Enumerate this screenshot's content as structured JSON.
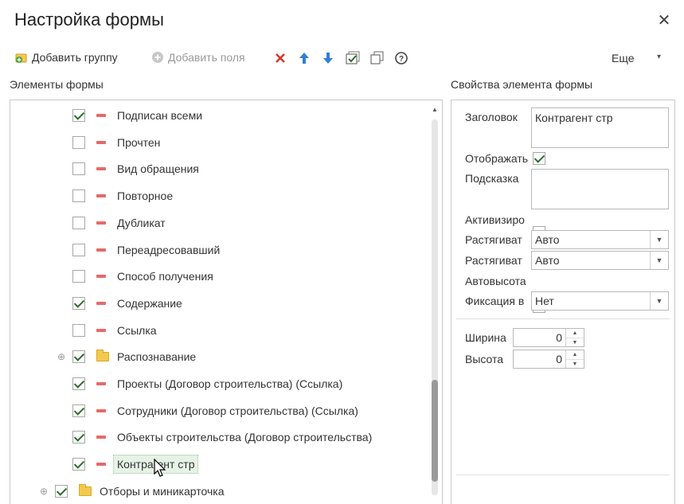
{
  "window": {
    "title": "Настройка формы",
    "close_glyph": "✕"
  },
  "toolbar": {
    "add_group": "Добавить группу",
    "add_field": "Добавить поля",
    "more": "Еще",
    "more_arrow": "▾"
  },
  "left_panel": {
    "heading": "Элементы формы",
    "rows": [
      {
        "label": "Подписан всеми",
        "checked": true,
        "icon": "minus-icon"
      },
      {
        "label": "Прочтен",
        "checked": false,
        "icon": "minus-icon"
      },
      {
        "label": "Вид обращения",
        "checked": false,
        "icon": "minus-icon"
      },
      {
        "label": "Повторное",
        "checked": false,
        "icon": "minus-icon"
      },
      {
        "label": "Дубликат",
        "checked": false,
        "icon": "minus-icon"
      },
      {
        "label": "Переадресовавший",
        "checked": false,
        "icon": "minus-icon"
      },
      {
        "label": "Способ получения",
        "checked": false,
        "icon": "minus-icon"
      },
      {
        "label": "Содержание",
        "checked": true,
        "icon": "minus-icon"
      },
      {
        "label": "Ссылка",
        "checked": false,
        "icon": "minus-icon"
      },
      {
        "label": "Распознавание",
        "checked": true,
        "icon": "folder-icon",
        "expander": "⊕"
      },
      {
        "label": "Проекты (Договор строительства) (Ссылка)",
        "checked": true,
        "icon": "minus-icon"
      },
      {
        "label": "Сотрудники (Договор строительства) (Ссылка)",
        "checked": true,
        "icon": "minus-icon"
      },
      {
        "label": "Объекты строительства (Договор строительства)",
        "checked": true,
        "icon": "minus-icon"
      },
      {
        "label": "Контрагент стр",
        "checked": true,
        "icon": "minus-icon",
        "selected": true
      },
      {
        "label": "Отборы и миникарточка",
        "checked": true,
        "icon": "folder-icon",
        "expander": "⊕"
      }
    ]
  },
  "right_panel": {
    "heading": "Свойства элемента формы",
    "caption_label": "Заголовок",
    "caption_value": "Контрагент стр",
    "show_label": "Отображать",
    "show_checked": true,
    "tooltip_label": "Подсказка",
    "tooltip_value": "",
    "activate_label": "Активизиро",
    "activate_checked": false,
    "stretch_h_label": "Растягиват",
    "stretch_h_value": "Авто",
    "stretch_v_label": "Растягиват",
    "stretch_v_value": "Авто",
    "autoheight_label": "Автовысота",
    "autoheight_checked": false,
    "fixation_label": "Фиксация в",
    "fixation_value": "Нет",
    "width_label": "Ширина",
    "width_value": "0",
    "height_label": "Высота",
    "height_value": "0"
  },
  "colors": {
    "delete": "#d9362b",
    "arrow": "#2f7fd6",
    "check": "#2e6e2e",
    "row_icon": "#e46a6a",
    "folder": "#f3c94d"
  }
}
